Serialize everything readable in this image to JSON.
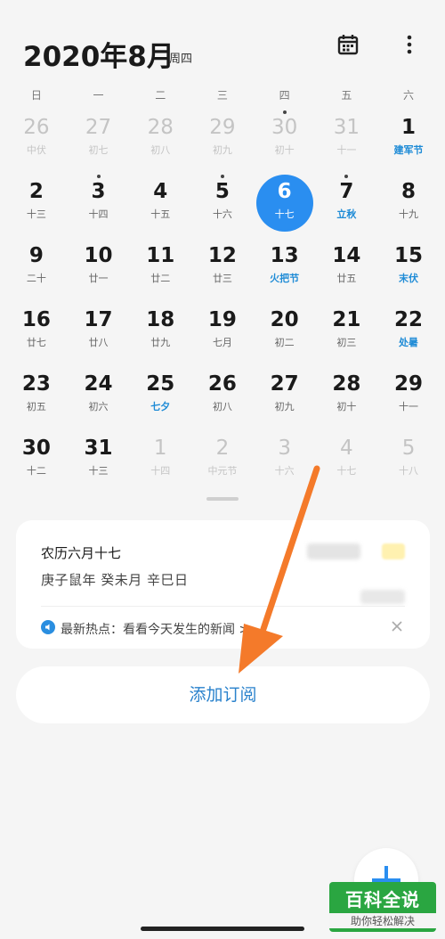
{
  "header": {
    "title": "2020年8月",
    "weekday": "周四"
  },
  "weekdays": [
    "日",
    "一",
    "二",
    "三",
    "四",
    "五",
    "六"
  ],
  "calendar": {
    "rows": [
      [
        {
          "d": "26",
          "l": "中伏",
          "m": true,
          "dot": false,
          "fest": false,
          "today": false
        },
        {
          "d": "27",
          "l": "初七",
          "m": true,
          "dot": false,
          "fest": false,
          "today": false
        },
        {
          "d": "28",
          "l": "初八",
          "m": true,
          "dot": false,
          "fest": false,
          "today": false
        },
        {
          "d": "29",
          "l": "初九",
          "m": true,
          "dot": false,
          "fest": false,
          "today": false
        },
        {
          "d": "30",
          "l": "初十",
          "m": true,
          "dot": true,
          "fest": false,
          "today": false
        },
        {
          "d": "31",
          "l": "十一",
          "m": true,
          "dot": false,
          "fest": false,
          "today": false
        },
        {
          "d": "1",
          "l": "建军节",
          "m": false,
          "dot": false,
          "fest": true,
          "today": false
        }
      ],
      [
        {
          "d": "2",
          "l": "十三",
          "m": false,
          "dot": false,
          "fest": false,
          "today": false
        },
        {
          "d": "3",
          "l": "十四",
          "m": false,
          "dot": true,
          "fest": false,
          "today": false
        },
        {
          "d": "4",
          "l": "十五",
          "m": false,
          "dot": false,
          "fest": false,
          "today": false
        },
        {
          "d": "5",
          "l": "十六",
          "m": false,
          "dot": true,
          "fest": false,
          "today": false
        },
        {
          "d": "6",
          "l": "十七",
          "m": false,
          "dot": false,
          "fest": false,
          "today": true
        },
        {
          "d": "7",
          "l": "立秋",
          "m": false,
          "dot": true,
          "fest": true,
          "today": false
        },
        {
          "d": "8",
          "l": "十九",
          "m": false,
          "dot": false,
          "fest": false,
          "today": false
        }
      ],
      [
        {
          "d": "9",
          "l": "二十",
          "m": false,
          "dot": false,
          "fest": false,
          "today": false
        },
        {
          "d": "10",
          "l": "廿一",
          "m": false,
          "dot": false,
          "fest": false,
          "today": false
        },
        {
          "d": "11",
          "l": "廿二",
          "m": false,
          "dot": false,
          "fest": false,
          "today": false
        },
        {
          "d": "12",
          "l": "廿三",
          "m": false,
          "dot": false,
          "fest": false,
          "today": false
        },
        {
          "d": "13",
          "l": "火把节",
          "m": false,
          "dot": false,
          "fest": true,
          "today": false
        },
        {
          "d": "14",
          "l": "廿五",
          "m": false,
          "dot": false,
          "fest": false,
          "today": false
        },
        {
          "d": "15",
          "l": "末伏",
          "m": false,
          "dot": false,
          "fest": true,
          "today": false
        }
      ],
      [
        {
          "d": "16",
          "l": "廿七",
          "m": false,
          "dot": false,
          "fest": false,
          "today": false
        },
        {
          "d": "17",
          "l": "廿八",
          "m": false,
          "dot": false,
          "fest": false,
          "today": false
        },
        {
          "d": "18",
          "l": "廿九",
          "m": false,
          "dot": false,
          "fest": false,
          "today": false
        },
        {
          "d": "19",
          "l": "七月",
          "m": false,
          "dot": false,
          "fest": false,
          "today": false
        },
        {
          "d": "20",
          "l": "初二",
          "m": false,
          "dot": false,
          "fest": false,
          "today": false
        },
        {
          "d": "21",
          "l": "初三",
          "m": false,
          "dot": false,
          "fest": false,
          "today": false
        },
        {
          "d": "22",
          "l": "处暑",
          "m": false,
          "dot": false,
          "fest": true,
          "today": false
        }
      ],
      [
        {
          "d": "23",
          "l": "初五",
          "m": false,
          "dot": false,
          "fest": false,
          "today": false
        },
        {
          "d": "24",
          "l": "初六",
          "m": false,
          "dot": false,
          "fest": false,
          "today": false
        },
        {
          "d": "25",
          "l": "七夕",
          "m": false,
          "dot": false,
          "fest": true,
          "today": false
        },
        {
          "d": "26",
          "l": "初八",
          "m": false,
          "dot": false,
          "fest": false,
          "today": false
        },
        {
          "d": "27",
          "l": "初九",
          "m": false,
          "dot": false,
          "fest": false,
          "today": false
        },
        {
          "d": "28",
          "l": "初十",
          "m": false,
          "dot": false,
          "fest": false,
          "today": false
        },
        {
          "d": "29",
          "l": "十一",
          "m": false,
          "dot": false,
          "fest": false,
          "today": false
        }
      ],
      [
        {
          "d": "30",
          "l": "十二",
          "m": false,
          "dot": false,
          "fest": false,
          "today": false
        },
        {
          "d": "31",
          "l": "十三",
          "m": false,
          "dot": false,
          "fest": false,
          "today": false
        },
        {
          "d": "1",
          "l": "十四",
          "m": true,
          "dot": false,
          "fest": false,
          "today": false
        },
        {
          "d": "2",
          "l": "中元节",
          "m": true,
          "dot": false,
          "fest": false,
          "today": false
        },
        {
          "d": "3",
          "l": "十六",
          "m": true,
          "dot": false,
          "fest": false,
          "today": false
        },
        {
          "d": "4",
          "l": "十七",
          "m": true,
          "dot": false,
          "fest": false,
          "today": false
        },
        {
          "d": "5",
          "l": "十八",
          "m": true,
          "dot": false,
          "fest": false,
          "today": false
        }
      ]
    ]
  },
  "info_card": {
    "lunar_date": "农历六月十七",
    "ganzhi": "庚子鼠年 癸未月 辛巳日",
    "news": "最新热点：看看今天发生的新闻 >"
  },
  "subscribe_label": "添加订阅",
  "watermark": {
    "title": "百科全说",
    "subtitle": "助你轻松解决"
  },
  "colors": {
    "accent": "#2a8ef0",
    "festival": "#1e8bd6",
    "annotation_arrow": "#f47a2a"
  },
  "icons": [
    "calendar-icon",
    "more-vertical-icon",
    "speaker-icon",
    "close-icon",
    "plus-icon"
  ]
}
